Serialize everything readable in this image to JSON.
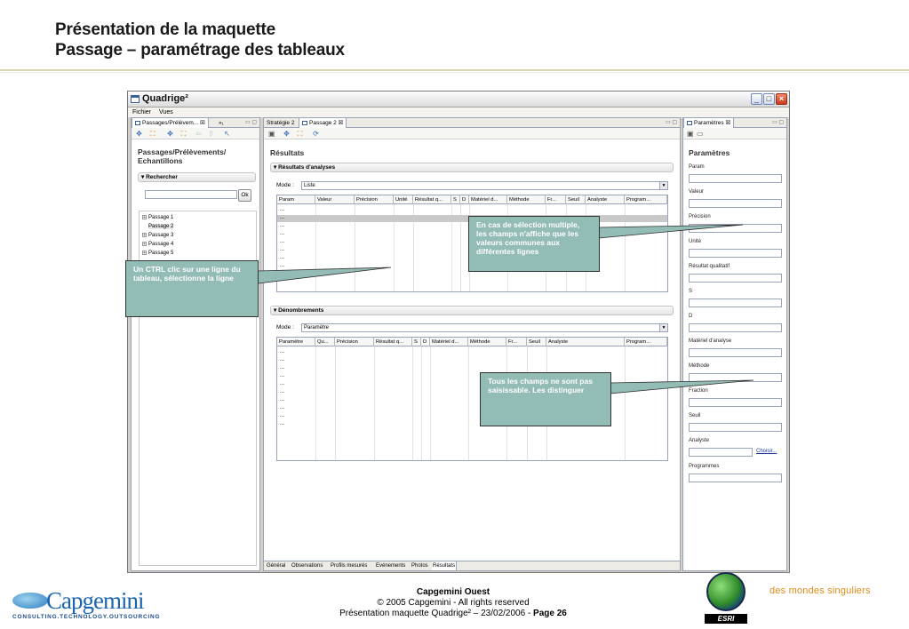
{
  "slide": {
    "title_line1": "Présentation de la maquette",
    "title_line2": "Passage – paramétrage des tableaux"
  },
  "app": {
    "window_title": "Quadrige²",
    "menu": [
      "Fichier",
      "Vues"
    ],
    "left_panel": {
      "tab_label": "Passages/Prélèvem...",
      "tab_close": "☒",
      "tab_extra": "»₁",
      "heading_line1": "Passages/Prélèvements/",
      "heading_line2": "Echantillons",
      "search_section": "Rechercher",
      "ok_label": "Ok",
      "tree_items": [
        "Passage 1",
        "Passage 2",
        "Passage 3",
        "Passage 4",
        "Passage 5"
      ]
    },
    "center_panel": {
      "tabs": [
        "Stratégie 2",
        "Passage 2"
      ],
      "tab_close": "☒",
      "heading": "Résultats",
      "section1": "Résultats d'analyses",
      "mode_label": "Mode :",
      "mode1_value": "Liste",
      "grid1_columns": [
        "Param",
        "Valeur",
        "Précision",
        "Unité",
        "Résultat q...",
        "S",
        "D",
        "Matériel d...",
        "Méthode",
        "Fr...",
        "Seuil",
        "Analyste",
        "Program..."
      ],
      "grid1_rows": [
        "...",
        "...",
        "...",
        "...",
        "...",
        "...",
        "...",
        "..."
      ],
      "section2": "Dénombrements",
      "mode2_value": "Paramètre",
      "grid2_columns": [
        "Paramètre",
        "Qu...",
        "Précision",
        "Résultat q...",
        "S",
        "D",
        "Matériel d...",
        "Méthode",
        "Fr...",
        "Seuil",
        "Analyste",
        "Program..."
      ],
      "grid2_rows": [
        "...",
        "...",
        "...",
        "...",
        "...",
        "...",
        "...",
        "...",
        "...",
        "..."
      ],
      "bottom_tabs": [
        "Général",
        "Observations",
        "Profils mesurés",
        "Evénements",
        "Photos",
        "Résultats"
      ]
    },
    "right_panel": {
      "tab_label": "Paramètres",
      "tab_close": "☒",
      "heading": "Paramètres",
      "fields": [
        "Param",
        "Valeur",
        "Précision",
        "Unité",
        "Résultat qualitatif",
        "S",
        "D",
        "Matériel d'analyse",
        "Méthode",
        "Fraction",
        "Seuil",
        "Analyste",
        "Programmes"
      ],
      "choose_link": "Choisir..."
    }
  },
  "callouts": {
    "left": "Un CTRL clic sur une ligne du tableau, sélectionne la ligne",
    "top_right": "En cas de sélection multiple, les champs n'affiche que les valeurs communes aux différentes lignes",
    "bottom_right": "Tous les champs ne sont pas saisissable. Les distinguer"
  },
  "footer": {
    "company": "Capgemini Ouest",
    "copyright": "© 2005 Capgemini - All rights reserved",
    "page_info_prefix": "Présentation maquette Quadrige² – 23/02/2006 - ",
    "page_label": "Page 26",
    "logo_word": "Capgemini",
    "logo_sub": "CONSULTING.TECHNOLOGY.OUTSOURCING",
    "esri": "ESRI",
    "tagline": "des mondes singuliers"
  },
  "colors": {
    "callout": "#93bcb6",
    "brand_blue": "#1a64b0",
    "tagline_orange": "#e08a1a"
  }
}
